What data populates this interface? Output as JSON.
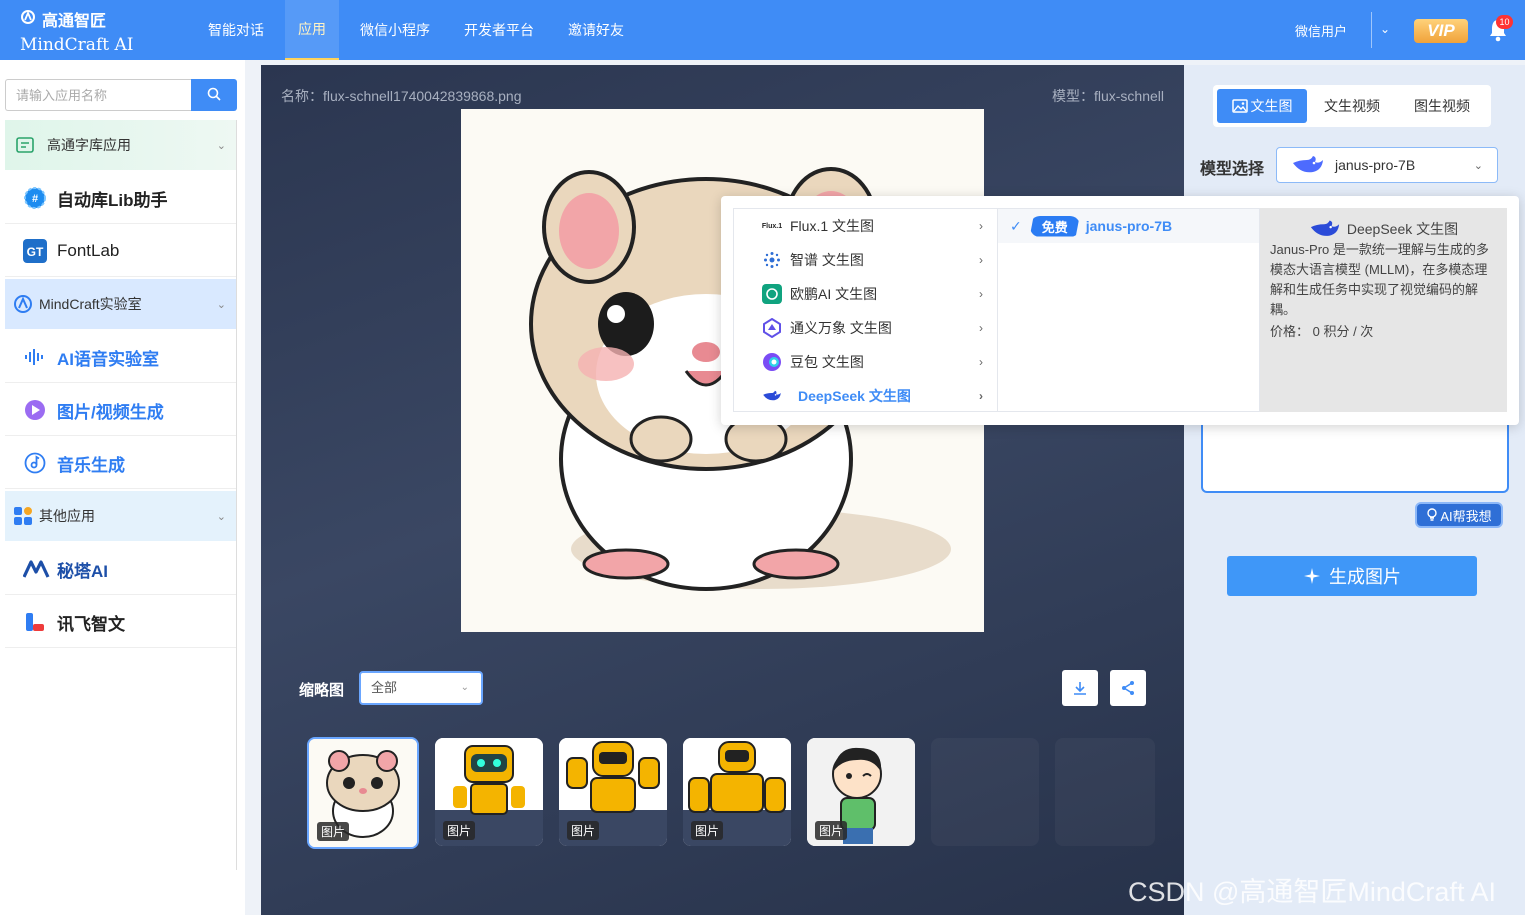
{
  "header": {
    "logo_cn": "高通智匠",
    "logo_en": "MindCraft AI",
    "nav": [
      {
        "label": "智能对话"
      },
      {
        "label": "应用"
      },
      {
        "label": "微信小程序"
      },
      {
        "label": "开发者平台"
      },
      {
        "label": "邀请好友"
      }
    ],
    "user": "微信用户",
    "vip": "VIP",
    "notifications": "10"
  },
  "sidebar": {
    "search_placeholder": "请输入应用名称",
    "groups": [
      {
        "label": "高通字库应用",
        "apps": [
          {
            "label": "自动库Lib助手"
          },
          {
            "label": "FontLab"
          }
        ]
      },
      {
        "label": "MindCraft实验室",
        "apps": [
          {
            "label": "AI语音实验室"
          },
          {
            "label": "图片/视频生成"
          },
          {
            "label": "音乐生成"
          }
        ]
      },
      {
        "label": "其他应用",
        "apps": [
          {
            "label": "秘塔AI"
          },
          {
            "label": "讯飞智文"
          }
        ]
      }
    ]
  },
  "main": {
    "name_label": "名称：flux-schnell1740042839868.png",
    "model_label": "模型：flux-schnell",
    "thumb_label": "缩略图",
    "filter_value": "全部",
    "thumb_tag": "图片"
  },
  "right": {
    "tabs": [
      {
        "label": "文生图"
      },
      {
        "label": "文生视频"
      },
      {
        "label": "图生视频"
      }
    ],
    "model_label": "模型选择",
    "model_value": "janus-pro-7B",
    "ai_help": "AI帮我想",
    "generate": "生成图片"
  },
  "dropdown": {
    "providers": [
      {
        "label": "Flux.1 文生图",
        "icon": "flux-icon"
      },
      {
        "label": "智谱 文生图",
        "icon": "zhipu-icon"
      },
      {
        "label": "欧鹏AI 文生图",
        "icon": "openai-icon"
      },
      {
        "label": "通义万象 文生图",
        "icon": "tongyi-icon"
      },
      {
        "label": "豆包 文生图",
        "icon": "doubao-icon"
      },
      {
        "label": "DeepSeek 文生图",
        "icon": "deepseek-icon"
      }
    ],
    "flux_mini": "Flux.1",
    "model_badge": "免费",
    "model_name": "janus-pro-7B",
    "desc_title": "DeepSeek 文生图",
    "desc_text": "Janus-Pro 是一款统一理解与生成的多模态大语言模型 (MLLM)，在多模态理解和生成任务中实现了视觉编码的解耦。",
    "price": "价格：  0 积分 / 次"
  },
  "watermark": "CSDN @高通智匠MindCraft AI",
  "colors": {
    "primary": "#3f8cf6",
    "header": "#3f8cf6"
  }
}
